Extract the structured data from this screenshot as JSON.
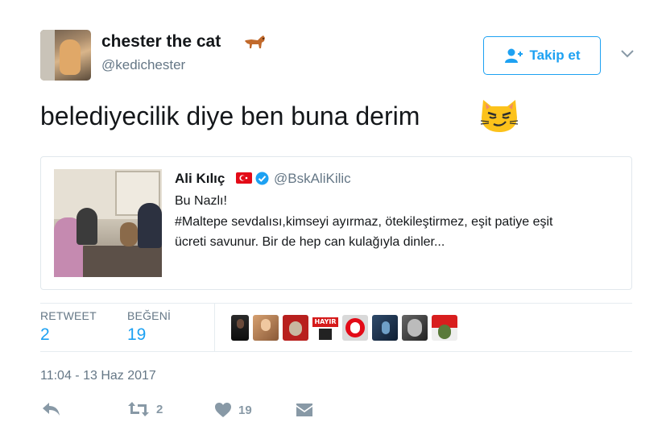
{
  "author": {
    "display_name": "chester the cat",
    "handle": "@kedichester",
    "name_emoji": "dog-emoji"
  },
  "follow_button": {
    "label": "Takip et",
    "icon": "add-user-icon"
  },
  "menu_icon": "chevron-down-icon",
  "tweet": {
    "text": "belediyecilik diye ben buna derim",
    "emoji": "smirking-cat-emoji"
  },
  "quote": {
    "name": "Ali Kılıç",
    "handle": "@BskAliKilic",
    "flag": "turkey-flag-icon",
    "verified": "verified-badge-icon",
    "lines": [
      "Bu Nazlı!",
      "#Maltepe sevdalısı,kimseyi ayırmaz, ötekileştirmez, eşit patiye eşit",
      "ücreti savunur. Bir de hep can kulağıyla dinler..."
    ]
  },
  "stats": {
    "retweet_label": "RETWEET",
    "retweet_count": "2",
    "like_label": "BEĞENİ",
    "like_count": "19",
    "likers_shown": 9,
    "liker_badge_text": "HAYIR"
  },
  "timestamp": "11:04 - 13 Haz 2017",
  "actions": {
    "reply_icon": "reply-icon",
    "retweet_icon": "retweet-icon",
    "retweet_count": "2",
    "like_icon": "heart-icon",
    "like_count": "19",
    "message_icon": "envelope-icon"
  },
  "colors": {
    "accent": "#1da1f2",
    "muted": "#657786",
    "text": "#14171a",
    "border": "#e1e8ed"
  }
}
